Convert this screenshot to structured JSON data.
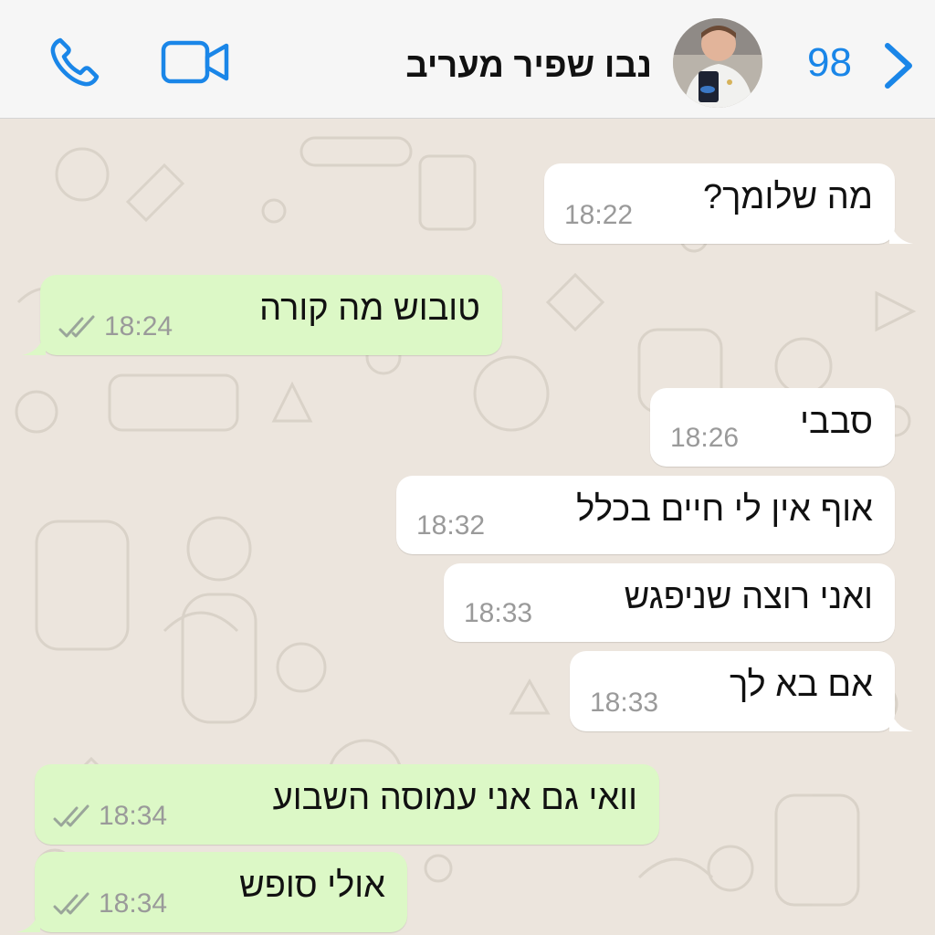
{
  "header": {
    "contact_name": "נבו שפיר מעריב",
    "back_count": "98",
    "icons": {
      "call": "phone-icon",
      "video": "video-camera-icon",
      "back": "chevron-right-icon"
    },
    "accent_color": "#1a86e8"
  },
  "chat": {
    "wallpaper_color": "#ece5dd",
    "incoming_color": "#ffffff",
    "outgoing_color": "#dcf8c6",
    "messages": [
      {
        "direction": "incoming",
        "text": "מה שלומך?",
        "time": "18:22"
      },
      {
        "direction": "outgoing",
        "text": "טובוש מה קורה",
        "time": "18:24",
        "status": "read"
      },
      {
        "direction": "incoming",
        "text": "סבבי",
        "time": "18:26"
      },
      {
        "direction": "incoming",
        "text": "אוף אין לי חיים בכלל",
        "time": "18:32"
      },
      {
        "direction": "incoming",
        "text": "ואני רוצה שניפגש",
        "time": "18:33"
      },
      {
        "direction": "incoming",
        "text": "אם בא לך",
        "time": "18:33"
      },
      {
        "direction": "outgoing",
        "text": "וואי גם אני עמוסה השבוע",
        "time": "18:34",
        "status": "read"
      },
      {
        "direction": "outgoing",
        "text": "אולי סופש",
        "time": "18:34",
        "status": "read"
      }
    ]
  }
}
